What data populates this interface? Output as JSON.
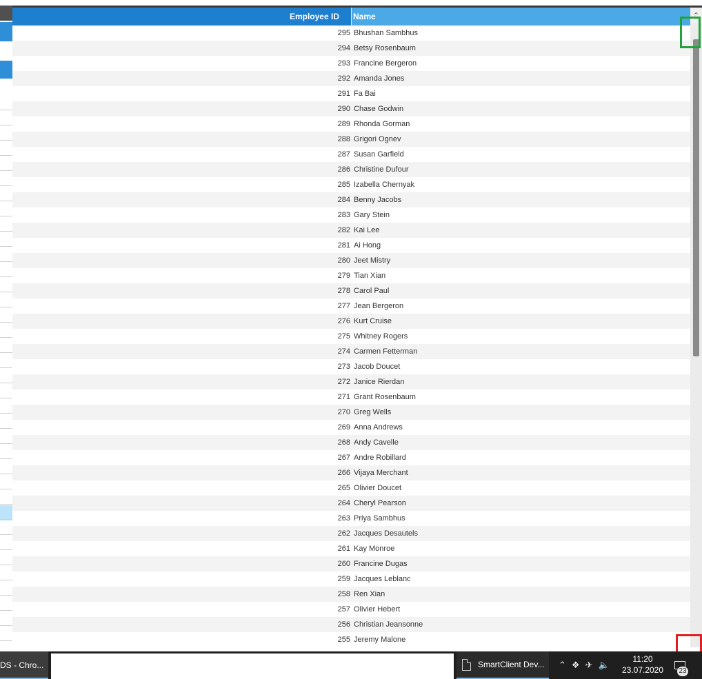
{
  "grid": {
    "columns": [
      "Employee ID",
      "Name"
    ],
    "rows": [
      [
        "295",
        "Bhushan Sambhus"
      ],
      [
        "294",
        "Betsy Rosenbaum"
      ],
      [
        "293",
        "Francine Bergeron"
      ],
      [
        "292",
        "Amanda Jones"
      ],
      [
        "291",
        "Fa Bai"
      ],
      [
        "290",
        "Chase Godwin"
      ],
      [
        "289",
        "Rhonda Gorman"
      ],
      [
        "288",
        "Grigori Ognev"
      ],
      [
        "287",
        "Susan Garfield"
      ],
      [
        "286",
        "Christine Dufour"
      ],
      [
        "285",
        "Izabella Chernyak"
      ],
      [
        "284",
        "Benny Jacobs"
      ],
      [
        "283",
        "Gary Stein"
      ],
      [
        "282",
        "Kai Lee"
      ],
      [
        "281",
        "Ai Hong"
      ],
      [
        "280",
        "Jeet Mistry"
      ],
      [
        "279",
        "Tian Xian"
      ],
      [
        "278",
        "Carol Paul"
      ],
      [
        "277",
        "Jean Bergeron"
      ],
      [
        "276",
        "Kurt Cruise"
      ],
      [
        "275",
        "Whitney Rogers"
      ],
      [
        "274",
        "Carmen Fetterman"
      ],
      [
        "273",
        "Jacob Doucet"
      ],
      [
        "272",
        "Janice Rierdan"
      ],
      [
        "271",
        "Grant Rosenbaum"
      ],
      [
        "270",
        "Greg Wells"
      ],
      [
        "269",
        "Anna Andrews"
      ],
      [
        "268",
        "Andy Cavelle"
      ],
      [
        "267",
        "Andre Robillard"
      ],
      [
        "266",
        "Vijaya Merchant"
      ],
      [
        "265",
        "Olivier Doucet"
      ],
      [
        "264",
        "Cheryl Pearson"
      ],
      [
        "263",
        "Priya Sambhus"
      ],
      [
        "262",
        "Jacques Desautels"
      ],
      [
        "261",
        "Kay Monroe"
      ],
      [
        "260",
        "Francine Dugas"
      ],
      [
        "259",
        "Jacques Leblanc"
      ],
      [
        "258",
        "Ren Xian"
      ],
      [
        "257",
        "Olivier Hebert"
      ],
      [
        "256",
        "Christian Jeansonne"
      ],
      [
        "255",
        "Jeremy Malone"
      ]
    ]
  },
  "scrollbar": {
    "up_icon": "chevron-up-icon",
    "up_glyph": "^"
  },
  "taskbar": {
    "chrome_label": "DS - Chro...",
    "smartclient_label": "SmartClient Dev...",
    "tray_icons": [
      "chevron-up-icon",
      "dropbox-icon",
      "airplane-mode-icon",
      "volume-icon"
    ],
    "time": "11:20",
    "date": "23.07.2020",
    "notification_count": "23"
  },
  "colors": {
    "header_id": "#1f7fcf",
    "header_name": "#4ba9e6",
    "highlight_green": "#21a33a",
    "highlight_red": "#e02020",
    "taskbar": "#1f1f1f"
  }
}
